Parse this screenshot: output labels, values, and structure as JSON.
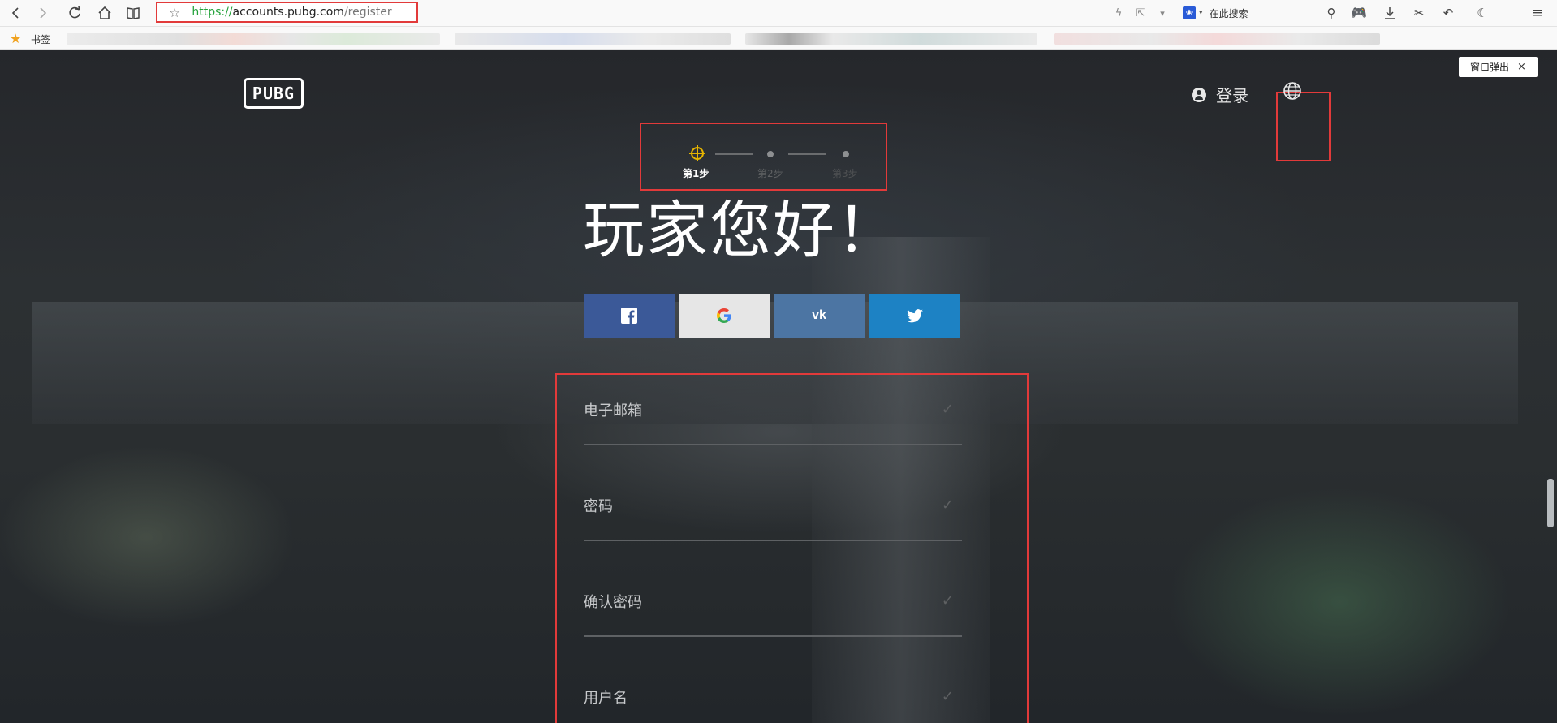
{
  "browser": {
    "url_prefix": "https://",
    "url_host": "accounts.pubg.com",
    "url_path": "/register",
    "search_placeholder": "在此搜索",
    "bookmarks_label": "书签",
    "icons": [
      "back-icon",
      "forward-icon",
      "reload-icon",
      "home-icon",
      "reader-icon",
      "bookmark-star-icon",
      "lightning-icon",
      "share-icon",
      "dropdown-icon",
      "search-icon",
      "game-icon",
      "download-icon",
      "scissors-icon",
      "undo-icon",
      "night-mode-icon",
      "menu-icon"
    ]
  },
  "page": {
    "window_popup_label": "窗口弹出",
    "window_popup_close": "×",
    "logo_text": "PUBG",
    "login_label": "登录",
    "steps": [
      {
        "label": "第1步",
        "state": "active"
      },
      {
        "label": "第2步",
        "state": "inactive"
      },
      {
        "label": "第3步",
        "state": "inactive"
      }
    ],
    "greeting": "玩家您好！",
    "social": {
      "facebook": "f",
      "google": "G",
      "vk": "vk",
      "twitter": "t"
    },
    "form": {
      "fields": [
        {
          "label": "电子邮箱",
          "check": "✓"
        },
        {
          "label": "密码",
          "check": "✓"
        },
        {
          "label": "确认密码",
          "check": "✓"
        },
        {
          "label": "用户名",
          "check": "✓"
        }
      ]
    }
  },
  "colors": {
    "facebook": "#3b5998",
    "google": "#e6e6e6",
    "vk": "#4c75a3",
    "twitter": "#1d82c4",
    "highlight_box": "#e23a3a",
    "active_step": "#e6b400"
  }
}
